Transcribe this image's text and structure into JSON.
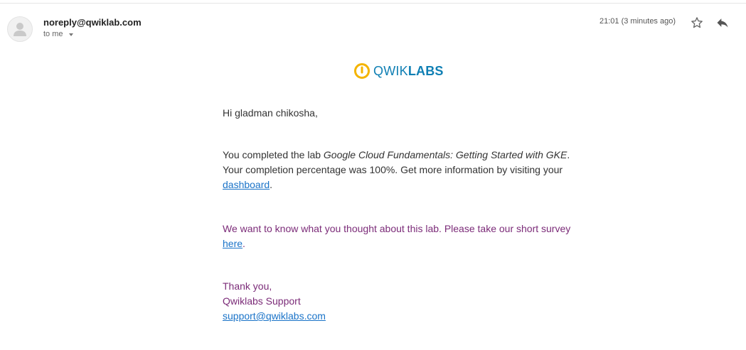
{
  "email": {
    "sender": "noreply@qwiklab.com",
    "recipient_label": "to me",
    "timestamp": "21:01 (3 minutes ago)",
    "icons": {
      "avatar": "default-avatar-icon",
      "star": "star-outline-icon",
      "reply": "reply-icon",
      "recipient_dropdown": "caret-down-icon"
    }
  },
  "logo": {
    "word_light": "QWIK",
    "word_bold": "LABS",
    "brand_color": "#0f7fb4",
    "icon_color": "#f4b400"
  },
  "content": {
    "greeting": "Hi gladman chikosha,",
    "completed_prefix": "You completed the lab ",
    "lab_name": "Google Cloud Fundamentals: Getting Started with GKE",
    "completed_suffix": ". Your completion percentage was 100%. Get more information by visiting your ",
    "dashboard_link": "dashboard",
    "completed_end": ".",
    "survey_text": "We want to know what you thought about this lab. Please take our short survey ",
    "survey_link": "here",
    "survey_end": ".",
    "thanks": "Thank you,",
    "team": "Qwiklabs Support",
    "support_email": "support@qwiklabs.com"
  },
  "colors": {
    "purple_text": "#7b2b78",
    "link": "#1a73c8"
  }
}
